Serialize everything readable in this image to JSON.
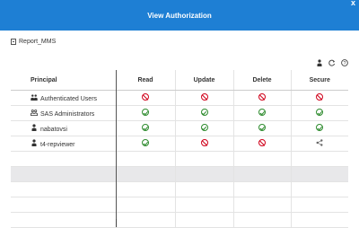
{
  "dialog": {
    "title": "View Authorization",
    "close_icon": "x"
  },
  "object": {
    "name": "Report_MMS",
    "icon": "document-icon"
  },
  "toolbar": {
    "icons": [
      "user-icon",
      "refresh-icon",
      "help-icon"
    ]
  },
  "table": {
    "headers": [
      "Principal",
      "Read",
      "Update",
      "Delete",
      "Secure"
    ],
    "rows": [
      {
        "principal": "Authenticated Users",
        "icon": "group-icon",
        "read": "deny",
        "update": "deny",
        "delete": "deny",
        "secure": "deny"
      },
      {
        "principal": "SAS Administrators",
        "icon": "admin-group-icon",
        "read": "grant",
        "update": "grant",
        "delete": "grant",
        "secure": "grant"
      },
      {
        "principal": "nabatovsi",
        "icon": "user-icon",
        "read": "grant",
        "update": "grant",
        "delete": "grant",
        "secure": "grant"
      },
      {
        "principal": "t4-repviewer",
        "icon": "user-icon",
        "read": "grant",
        "update": "deny",
        "delete": "deny",
        "secure": "share"
      }
    ]
  },
  "colors": {
    "titlebar": "#1e7fd4",
    "grant": "#2e8b2e",
    "deny": "#d0021b"
  }
}
